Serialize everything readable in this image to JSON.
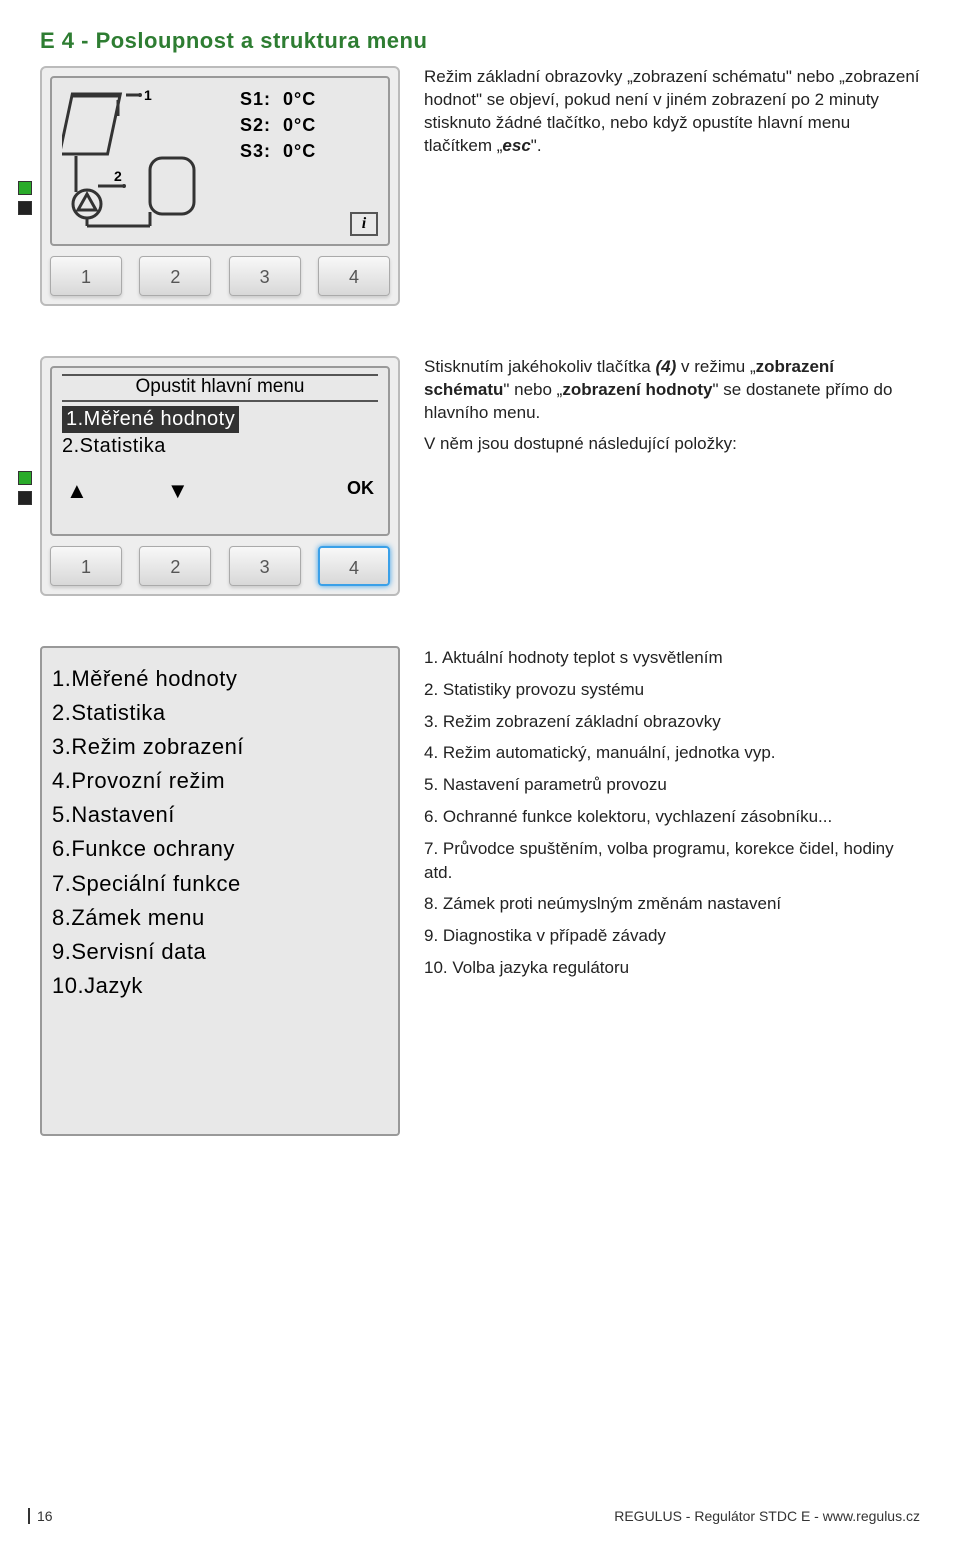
{
  "section_title": "E 4 - Posloupnost a struktura menu",
  "screen1": {
    "temps": [
      {
        "label": "S1:",
        "val": "0°C"
      },
      {
        "label": "S2:",
        "val": "0°C"
      },
      {
        "label": "S3:",
        "val": "0°C"
      }
    ],
    "sensor_top": "1",
    "sensor_mid": "2",
    "info": "i",
    "desc_html": "Režim základní obrazovky „zobrazení schématu\" nebo „zobrazení hodnot\" se objeví, pokud není v jiném zobrazení po 2 minuty stisknuto žádné tlačítko, nebo když opustíte hlavní menu tlačítkem „<b><i>esc</i></b>\"."
  },
  "screen2": {
    "title": "Opustit hlavní menu",
    "items": [
      "1.Měřené hodnoty",
      "2.Statistika"
    ],
    "selected_index": 0,
    "footer_ok": "OK",
    "desc_html": "Stisknutím jakéhokoliv tlačítka <b><i>(4)</i></b> v režimu „<b>zobrazení schématu</b>\" nebo „<b>zobrazení hodnoty</b>\" se dostanete přímo do hlavního menu.",
    "desc2": "V něm jsou dostupné následující položky:"
  },
  "keys": [
    "1",
    "2",
    "3",
    "4"
  ],
  "screen3": {
    "items": [
      "1.Měřené hodnoty",
      "2.Statistika",
      "3.Režim zobrazení",
      "4.Provozní režim",
      "5.Nastavení",
      "6.Funkce ochrany",
      "7.Speciální funkce",
      "8.Zámek menu",
      "9.Servisní data",
      "10.Jazyk"
    ]
  },
  "explanations": [
    "1. Aktuální hodnoty teplot s vysvětlením",
    "2. Statistiky provozu systému",
    "3. Režim zobrazení základní obrazovky",
    "4. Režim automatický, manuální, jednotka vyp.",
    "5. Nastavení parametrů provozu",
    "6. Ochranné funkce kolektoru, vychlazení zásobníku...",
    "7. Průvodce spuštěním, volba programu, korekce čidel, hodiny atd.",
    "8. Zámek proti neúmyslným změnám nastavení",
    "9. Diagnostika v případě závady",
    "10. Volba jazyka regulátoru"
  ],
  "footer": {
    "page": "16",
    "right": "REGULUS - Regulátor STDC E - www.regulus.cz"
  }
}
